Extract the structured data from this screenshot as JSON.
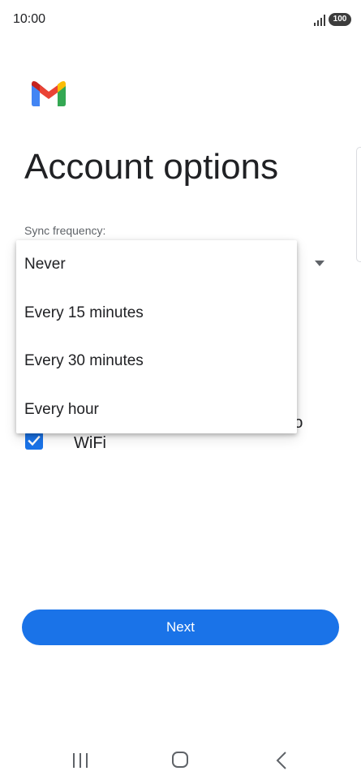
{
  "status_bar": {
    "time": "10:00",
    "battery": "100",
    "signal_icon": "signal-icon",
    "battery_icon": "battery-icon"
  },
  "logo": {
    "icon": "gmail-logo",
    "colors": {
      "blue": "#4285F4",
      "red": "#EA4335",
      "yellow": "#FBBC04",
      "green": "#34A853",
      "dark_red": "#C5221F"
    }
  },
  "title": "Account options",
  "sync": {
    "label": "Sync frequency:",
    "menu_items": [
      "Never",
      "Every 15 minutes",
      "Every 30 minutes",
      "Every hour"
    ]
  },
  "attachments_checkbox": {
    "checked": true,
    "label": "attachments when connected to WiFi"
  },
  "next_button": {
    "label": "Next"
  },
  "colors": {
    "accent": "#1a73e8",
    "text": "#202124",
    "secondary_text": "#5f6368"
  },
  "nav_bar": {
    "recents_icon": "recents-icon",
    "home_icon": "home-icon",
    "back_icon": "back-icon"
  }
}
